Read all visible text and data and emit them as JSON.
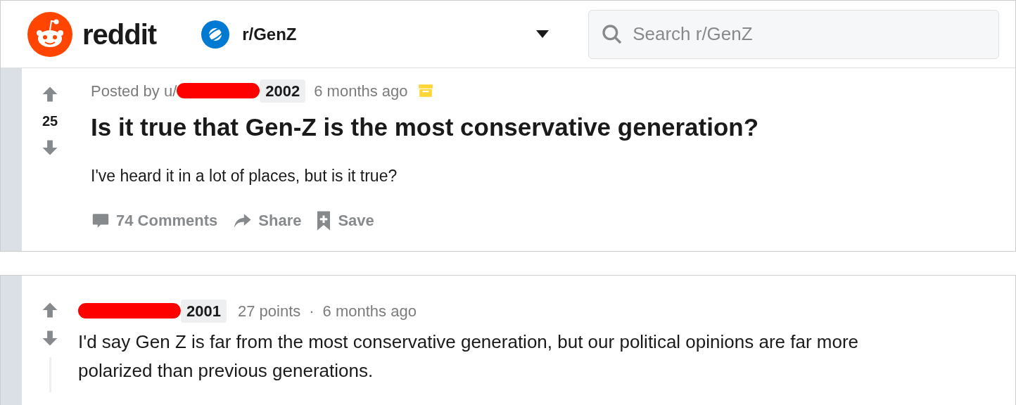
{
  "header": {
    "logo_text": "reddit",
    "community": "r/GenZ",
    "search": {
      "placeholder": "Search r/GenZ"
    }
  },
  "post": {
    "score": "25",
    "posted_by": "Posted by u/",
    "flair": "2002",
    "time": "6 months ago",
    "title": "Is it true that Gen-Z is the most conservative generation?",
    "body": "I've heard it in a lot of places, but is it true?",
    "actions": [
      {
        "kind": "comments",
        "label": "74 Comments"
      },
      {
        "kind": "share",
        "label": "Share"
      },
      {
        "kind": "save",
        "label": "Save"
      }
    ]
  },
  "comment": {
    "flair": "2001",
    "points": "27 points",
    "separator": "·",
    "time": "6 months ago",
    "body": "I'd say Gen Z is far from the most conservative generation, but our political opinions are far more polarized than previous generations."
  }
}
